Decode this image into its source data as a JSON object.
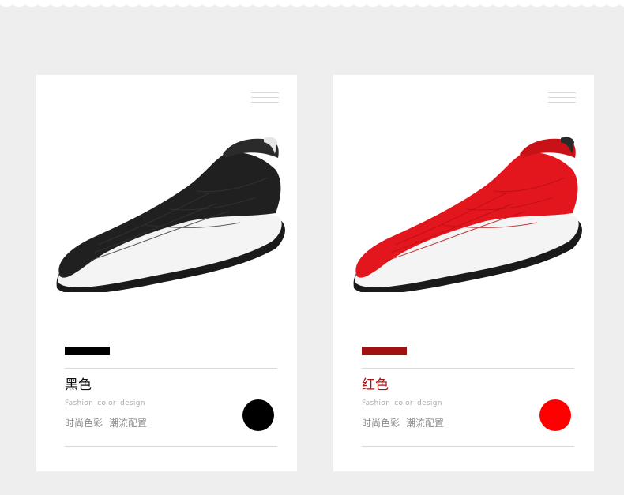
{
  "products": [
    {
      "title": "黑色",
      "subtitle": "Fashion  color  design",
      "desc_1": "时尚色彩",
      "desc_2": "潮流配置",
      "bar_color": "#000000",
      "title_color": "#111111",
      "swatch_color": "#000000",
      "shoe_color": "black"
    },
    {
      "title": "红色",
      "subtitle": "Fashion  color  design",
      "desc_1": "时尚色彩",
      "desc_2": "潮流配置",
      "bar_color": "#a01212",
      "title_color": "#a81616",
      "swatch_color": "#ff0000",
      "shoe_color": "red"
    }
  ]
}
